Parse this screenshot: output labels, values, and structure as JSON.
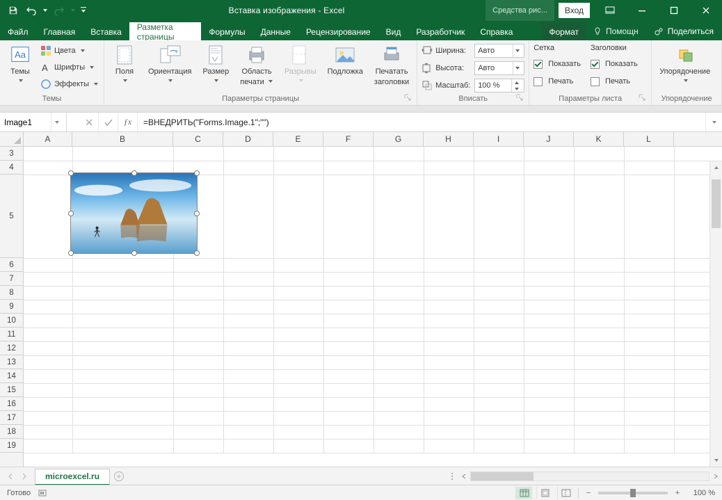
{
  "title": "Вставка изображения  -  Excel",
  "tool_context": "Средства рис...",
  "signin": "Вход",
  "tabs": [
    "Файл",
    "Главная",
    "Вставка",
    "Разметка страницы",
    "Формулы",
    "Данные",
    "Рецензирование",
    "Вид",
    "Разработчик",
    "Справка"
  ],
  "active_tab_index": 3,
  "context_tab": "Формат",
  "help_hint": "Помощн",
  "share": "Поделиться",
  "ribbon": {
    "themes": {
      "label": "Темы",
      "themes_btn": "Темы",
      "colors": "Цвета",
      "fonts": "Шрифты",
      "effects": "Эффекты"
    },
    "page_setup": {
      "label": "Параметры страницы",
      "margins": "Поля",
      "orientation": "Ориентация",
      "size": "Размер",
      "print_area1": "Область",
      "print_area2": "печати",
      "breaks": "Разрывы",
      "background": "Подложка",
      "print_titles1": "Печатать",
      "print_titles2": "заголовки"
    },
    "scale": {
      "label": "Вписать",
      "width_lbl": "Ширина:",
      "width_val": "Авто",
      "height_lbl": "Высота:",
      "height_val": "Авто",
      "scale_lbl": "Масштаб:",
      "scale_val": "100 %"
    },
    "sheet_opts": {
      "label": "Параметры листа",
      "grid": "Сетка",
      "headers": "Заголовки",
      "show": "Показать",
      "print": "Печать"
    },
    "arrange": {
      "label": "Упорядочение",
      "btn": "Упорядочение"
    }
  },
  "namebox": "Image1",
  "formula": "=ВНЕДРИТЬ(\"Forms.Image.1\";\"\")",
  "columns": [
    "A",
    "B",
    "C",
    "D",
    "E",
    "F",
    "G",
    "H",
    "I",
    "J",
    "K",
    "L"
  ],
  "row_labels": [
    "3",
    "4",
    "5",
    "6",
    "7",
    "8",
    "9",
    "10",
    "11",
    "12",
    "13",
    "14",
    "15",
    "16",
    "17",
    "18",
    "19"
  ],
  "sheet_tab": "microexcel.ru",
  "status_ready": "Готово",
  "zoom_pct": "100 %"
}
